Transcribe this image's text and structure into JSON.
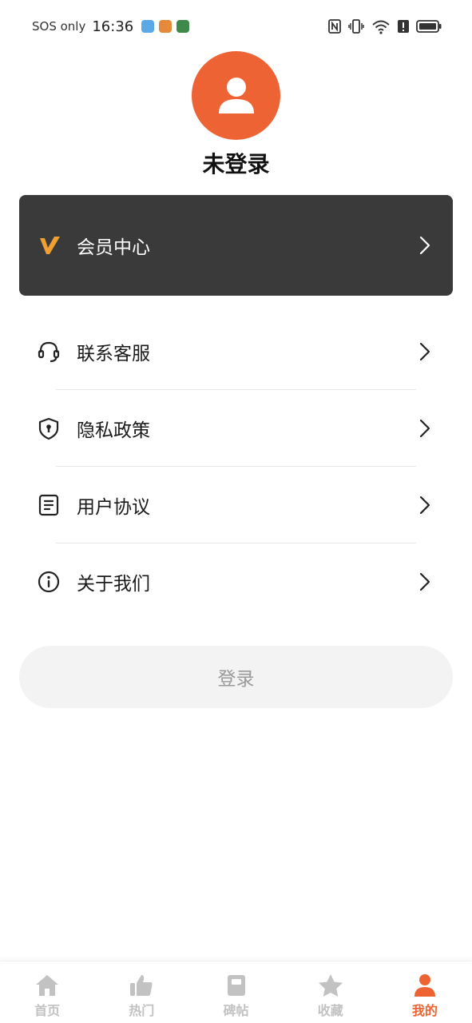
{
  "status_bar": {
    "network": "SOS only",
    "time": "16:36"
  },
  "profile": {
    "status": "未登录"
  },
  "membership": {
    "label": "会员中心"
  },
  "menu": {
    "items": [
      {
        "label": "联系客服",
        "icon": "headset-icon"
      },
      {
        "label": "隐私政策",
        "icon": "shield-lock-icon"
      },
      {
        "label": "用户协议",
        "icon": "document-icon"
      },
      {
        "label": "关于我们",
        "icon": "info-icon"
      }
    ]
  },
  "login_button": {
    "label": "登录"
  },
  "bottom_nav": {
    "items": [
      {
        "label": "首页",
        "icon": "home-icon"
      },
      {
        "label": "热门",
        "icon": "thumbs-up-icon"
      },
      {
        "label": "碑帖",
        "icon": "book-icon"
      },
      {
        "label": "收藏",
        "icon": "star-icon"
      },
      {
        "label": "我的",
        "icon": "person-icon"
      }
    ],
    "active": "我的"
  },
  "colors": {
    "accent": "#ee6333",
    "member_card_bg": "#3a3a3a",
    "member_logo": "#f0a030",
    "inactive_nav": "#c2c2c2"
  }
}
